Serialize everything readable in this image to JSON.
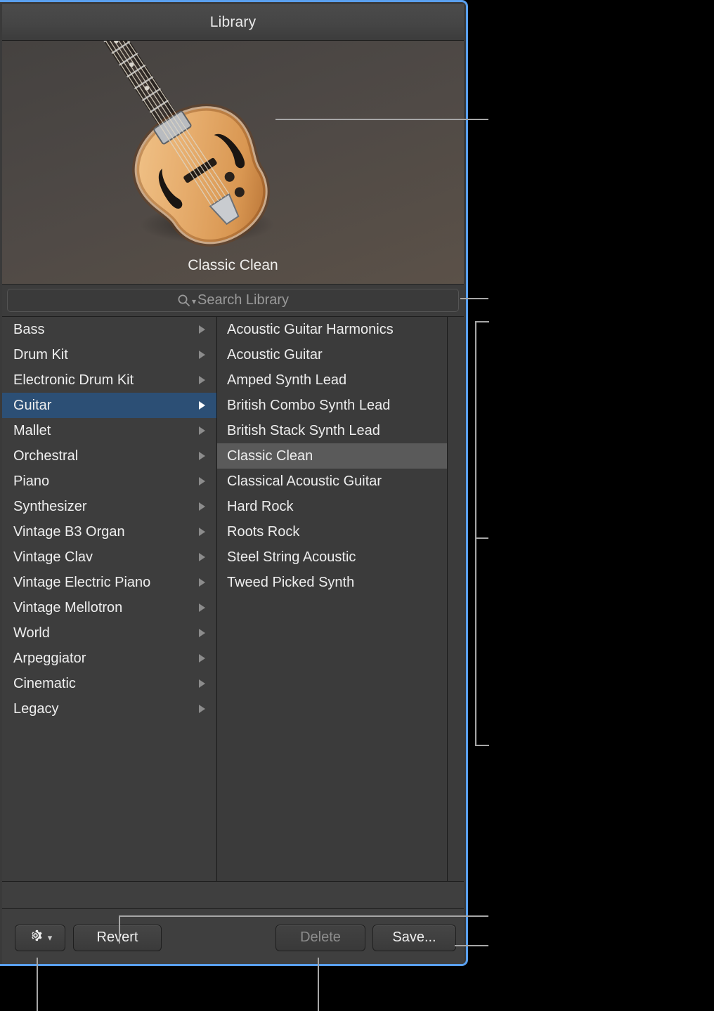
{
  "window": {
    "title": "Library"
  },
  "preview": {
    "patch_name": "Classic Clean",
    "instrument_icon": "archtop-guitar-icon"
  },
  "search": {
    "placeholder": "Search Library",
    "value": "",
    "icon": "magnifier-icon",
    "menu_icon": "chevron-down-icon"
  },
  "categories": [
    {
      "label": "Bass",
      "selected": false
    },
    {
      "label": "Drum Kit",
      "selected": false
    },
    {
      "label": "Electronic Drum Kit",
      "selected": false
    },
    {
      "label": "Guitar",
      "selected": true
    },
    {
      "label": "Mallet",
      "selected": false
    },
    {
      "label": "Orchestral",
      "selected": false
    },
    {
      "label": "Piano",
      "selected": false
    },
    {
      "label": "Synthesizer",
      "selected": false
    },
    {
      "label": "Vintage B3 Organ",
      "selected": false
    },
    {
      "label": "Vintage Clav",
      "selected": false
    },
    {
      "label": "Vintage Electric Piano",
      "selected": false
    },
    {
      "label": "Vintage Mellotron",
      "selected": false
    },
    {
      "label": "World",
      "selected": false
    },
    {
      "label": "Arpeggiator",
      "selected": false
    },
    {
      "label": "Cinematic",
      "selected": false
    },
    {
      "label": "Legacy",
      "selected": false
    }
  ],
  "patches": [
    {
      "label": "Acoustic Guitar Harmonics",
      "selected": false
    },
    {
      "label": "Acoustic Guitar",
      "selected": false
    },
    {
      "label": "Amped Synth Lead",
      "selected": false
    },
    {
      "label": "British Combo Synth Lead",
      "selected": false
    },
    {
      "label": "British Stack Synth Lead",
      "selected": false
    },
    {
      "label": "Classic Clean",
      "selected": true
    },
    {
      "label": "Classical Acoustic Guitar",
      "selected": false
    },
    {
      "label": "Hard Rock",
      "selected": false
    },
    {
      "label": "Roots Rock",
      "selected": false
    },
    {
      "label": "Steel String Acoustic",
      "selected": false
    },
    {
      "label": "Tweed Picked Synth",
      "selected": false
    }
  ],
  "toolbar": {
    "gear_icon": "gear-icon",
    "gear_chevron_icon": "chevron-down-icon",
    "revert_label": "Revert",
    "delete_label": "Delete",
    "delete_disabled": true,
    "save_label": "Save..."
  },
  "colors": {
    "selection_blue": "#2c4f75",
    "panel_focus_border": "#5aa0ef",
    "patch_selection_gray": "#5a5a5a",
    "callout_line": "#a7a7a7",
    "background": "#000000"
  }
}
